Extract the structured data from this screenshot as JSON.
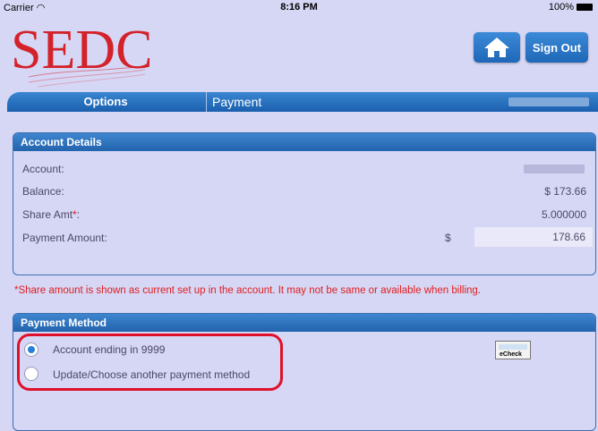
{
  "status_bar": {
    "carrier": "Carrier",
    "time": "8:16 PM",
    "battery": "100%"
  },
  "header": {
    "logo_text": "SEDC",
    "sign_out_label": "Sign Out"
  },
  "tabs": {
    "options_label": "Options",
    "payment_label": "Payment"
  },
  "account_details": {
    "title": "Account Details",
    "account_label": "Account:",
    "balance_label": "Balance:",
    "balance_value": "$ 173.66",
    "share_label": "Share Amt",
    "share_required_mark": "*",
    "share_colon": ":",
    "share_value": "5.000000",
    "payment_label": "Payment Amount:",
    "payment_currency": "$",
    "payment_value": "178.66"
  },
  "note": "*Share amount is shown as current set up in the account. It may not be same or available when billing.",
  "payment_method": {
    "title": "Payment Method",
    "options": [
      {
        "label": "Account ending in 9999",
        "selected": true
      },
      {
        "label": "Update/Choose another payment method",
        "selected": false
      }
    ],
    "echeck_label": "eCheck"
  },
  "colors": {
    "accent": "#2a73c4",
    "highlight": "#e0102a",
    "logo_red": "#d3222a",
    "background": "#d6d6f5"
  }
}
